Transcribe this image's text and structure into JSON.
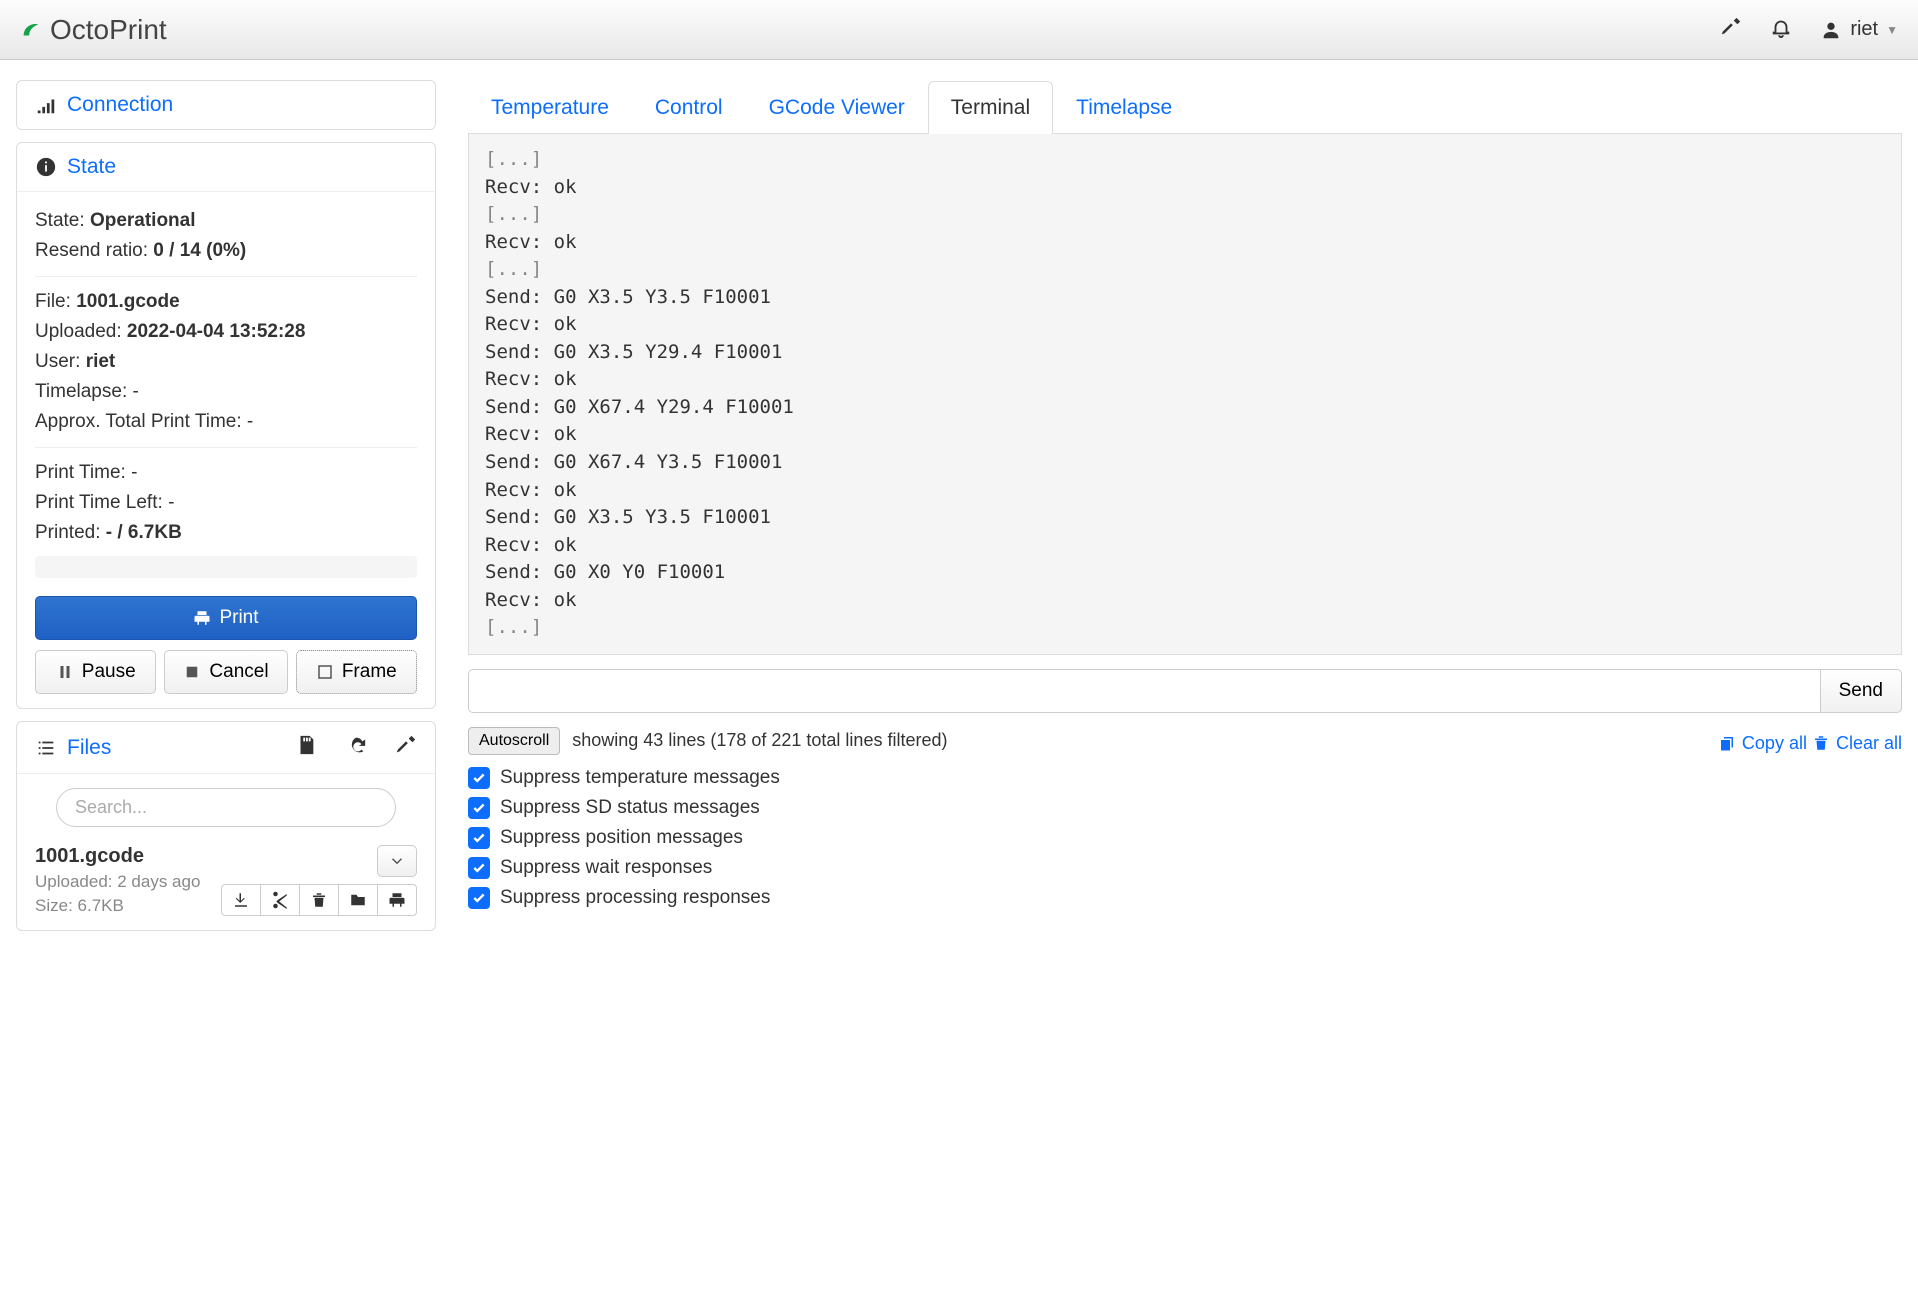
{
  "brand": "OctoPrint",
  "user": "riet",
  "sidebar": {
    "connection": {
      "title": "Connection"
    },
    "state": {
      "title": "State",
      "state_label": "State:",
      "state_value": "Operational",
      "resend_label": "Resend ratio:",
      "resend_value": "0 / 14 (0%)",
      "file_label": "File:",
      "file_value": "1001.gcode",
      "uploaded_label": "Uploaded:",
      "uploaded_value": "2022-04-04 13:52:28",
      "user_label": "User:",
      "user_value": "riet",
      "timelapse_label": "Timelapse:",
      "timelapse_value": "-",
      "approx_label": "Approx. Total Print Time:",
      "approx_value": "-",
      "printtime_label": "Print Time:",
      "printtime_value": "-",
      "printtimeleft_label": "Print Time Left:",
      "printtimeleft_value": "-",
      "printed_label": "Printed:",
      "printed_value": "- / 6.7KB",
      "print_btn": "Print",
      "pause_btn": "Pause",
      "cancel_btn": "Cancel",
      "frame_btn": "Frame"
    },
    "files": {
      "title": "Files",
      "search_placeholder": "Search...",
      "entry": {
        "name": "1001.gcode",
        "uploaded": "Uploaded: 2 days ago",
        "size": "Size: 6.7KB"
      }
    }
  },
  "tabs": {
    "temperature": "Temperature",
    "control": "Control",
    "gcode": "GCode Viewer",
    "terminal": "Terminal",
    "timelapse": "Timelapse"
  },
  "terminal": {
    "lines": [
      {
        "t": "[...]",
        "dim": true
      },
      {
        "t": "Recv: ok"
      },
      {
        "t": "[...]",
        "dim": true
      },
      {
        "t": "Recv: ok"
      },
      {
        "t": "[...]",
        "dim": true
      },
      {
        "t": "Send: G0 X3.5 Y3.5 F10001"
      },
      {
        "t": "Recv: ok"
      },
      {
        "t": "Send: G0 X3.5 Y29.4 F10001"
      },
      {
        "t": "Recv: ok"
      },
      {
        "t": "Send: G0 X67.4 Y29.4 F10001"
      },
      {
        "t": "Recv: ok"
      },
      {
        "t": "Send: G0 X67.4 Y3.5 F10001"
      },
      {
        "t": "Recv: ok"
      },
      {
        "t": "Send: G0 X3.5 Y3.5 F10001"
      },
      {
        "t": "Recv: ok"
      },
      {
        "t": "Send: G0 X0 Y0 F10001"
      },
      {
        "t": "Recv: ok"
      },
      {
        "t": "[...]",
        "dim": true
      }
    ],
    "send_btn": "Send",
    "autoscroll_btn": "Autoscroll",
    "showing": "showing 43 lines (178 of 221 total lines filtered)",
    "copy_all": "Copy all",
    "clear_all": "Clear all",
    "filters": [
      "Suppress temperature messages",
      "Suppress SD status messages",
      "Suppress position messages",
      "Suppress wait responses",
      "Suppress processing responses"
    ]
  }
}
